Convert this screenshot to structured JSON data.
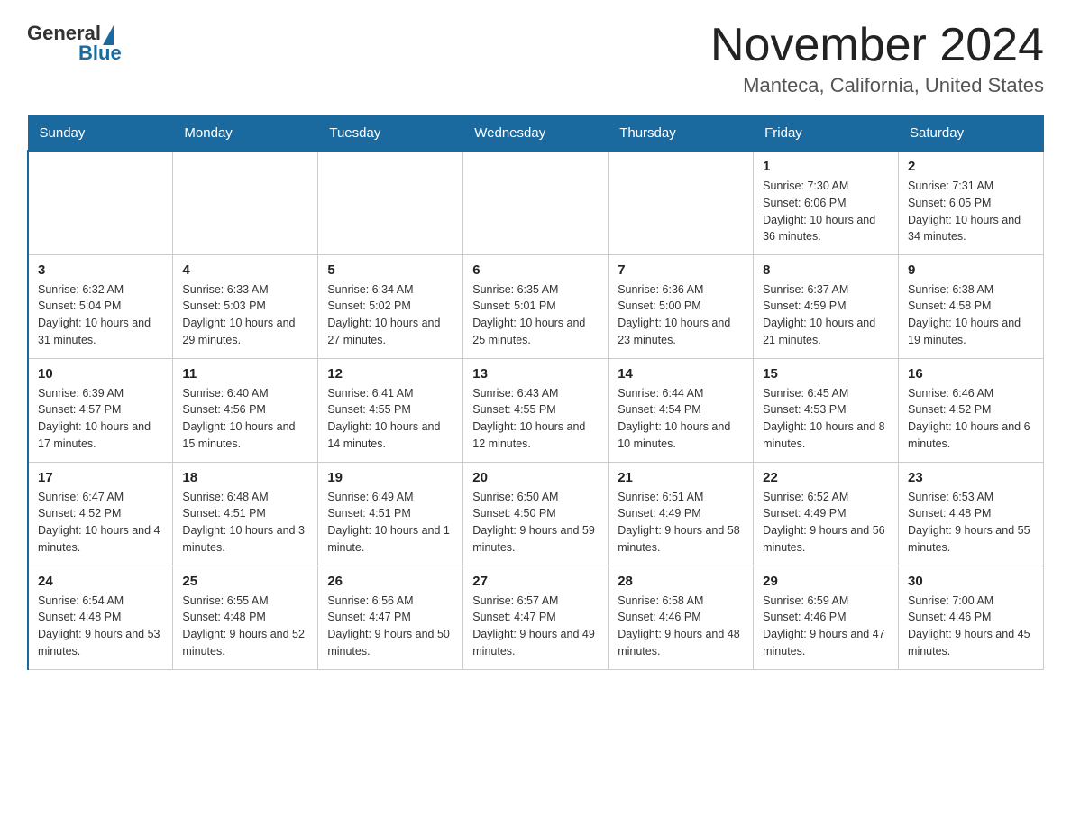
{
  "header": {
    "logo_general": "General",
    "logo_blue": "Blue",
    "month_title": "November 2024",
    "location": "Manteca, California, United States"
  },
  "days_of_week": [
    "Sunday",
    "Monday",
    "Tuesday",
    "Wednesday",
    "Thursday",
    "Friday",
    "Saturday"
  ],
  "weeks": [
    {
      "days": [
        {
          "number": "",
          "sunrise": "",
          "sunset": "",
          "daylight": "",
          "empty": true
        },
        {
          "number": "",
          "sunrise": "",
          "sunset": "",
          "daylight": "",
          "empty": true
        },
        {
          "number": "",
          "sunrise": "",
          "sunset": "",
          "daylight": "",
          "empty": true
        },
        {
          "number": "",
          "sunrise": "",
          "sunset": "",
          "daylight": "",
          "empty": true
        },
        {
          "number": "",
          "sunrise": "",
          "sunset": "",
          "daylight": "",
          "empty": true
        },
        {
          "number": "1",
          "sunrise": "Sunrise: 7:30 AM",
          "sunset": "Sunset: 6:06 PM",
          "daylight": "Daylight: 10 hours and 36 minutes.",
          "empty": false
        },
        {
          "number": "2",
          "sunrise": "Sunrise: 7:31 AM",
          "sunset": "Sunset: 6:05 PM",
          "daylight": "Daylight: 10 hours and 34 minutes.",
          "empty": false
        }
      ]
    },
    {
      "days": [
        {
          "number": "3",
          "sunrise": "Sunrise: 6:32 AM",
          "sunset": "Sunset: 5:04 PM",
          "daylight": "Daylight: 10 hours and 31 minutes.",
          "empty": false
        },
        {
          "number": "4",
          "sunrise": "Sunrise: 6:33 AM",
          "sunset": "Sunset: 5:03 PM",
          "daylight": "Daylight: 10 hours and 29 minutes.",
          "empty": false
        },
        {
          "number": "5",
          "sunrise": "Sunrise: 6:34 AM",
          "sunset": "Sunset: 5:02 PM",
          "daylight": "Daylight: 10 hours and 27 minutes.",
          "empty": false
        },
        {
          "number": "6",
          "sunrise": "Sunrise: 6:35 AM",
          "sunset": "Sunset: 5:01 PM",
          "daylight": "Daylight: 10 hours and 25 minutes.",
          "empty": false
        },
        {
          "number": "7",
          "sunrise": "Sunrise: 6:36 AM",
          "sunset": "Sunset: 5:00 PM",
          "daylight": "Daylight: 10 hours and 23 minutes.",
          "empty": false
        },
        {
          "number": "8",
          "sunrise": "Sunrise: 6:37 AM",
          "sunset": "Sunset: 4:59 PM",
          "daylight": "Daylight: 10 hours and 21 minutes.",
          "empty": false
        },
        {
          "number": "9",
          "sunrise": "Sunrise: 6:38 AM",
          "sunset": "Sunset: 4:58 PM",
          "daylight": "Daylight: 10 hours and 19 minutes.",
          "empty": false
        }
      ]
    },
    {
      "days": [
        {
          "number": "10",
          "sunrise": "Sunrise: 6:39 AM",
          "sunset": "Sunset: 4:57 PM",
          "daylight": "Daylight: 10 hours and 17 minutes.",
          "empty": false
        },
        {
          "number": "11",
          "sunrise": "Sunrise: 6:40 AM",
          "sunset": "Sunset: 4:56 PM",
          "daylight": "Daylight: 10 hours and 15 minutes.",
          "empty": false
        },
        {
          "number": "12",
          "sunrise": "Sunrise: 6:41 AM",
          "sunset": "Sunset: 4:55 PM",
          "daylight": "Daylight: 10 hours and 14 minutes.",
          "empty": false
        },
        {
          "number": "13",
          "sunrise": "Sunrise: 6:43 AM",
          "sunset": "Sunset: 4:55 PM",
          "daylight": "Daylight: 10 hours and 12 minutes.",
          "empty": false
        },
        {
          "number": "14",
          "sunrise": "Sunrise: 6:44 AM",
          "sunset": "Sunset: 4:54 PM",
          "daylight": "Daylight: 10 hours and 10 minutes.",
          "empty": false
        },
        {
          "number": "15",
          "sunrise": "Sunrise: 6:45 AM",
          "sunset": "Sunset: 4:53 PM",
          "daylight": "Daylight: 10 hours and 8 minutes.",
          "empty": false
        },
        {
          "number": "16",
          "sunrise": "Sunrise: 6:46 AM",
          "sunset": "Sunset: 4:52 PM",
          "daylight": "Daylight: 10 hours and 6 minutes.",
          "empty": false
        }
      ]
    },
    {
      "days": [
        {
          "number": "17",
          "sunrise": "Sunrise: 6:47 AM",
          "sunset": "Sunset: 4:52 PM",
          "daylight": "Daylight: 10 hours and 4 minutes.",
          "empty": false
        },
        {
          "number": "18",
          "sunrise": "Sunrise: 6:48 AM",
          "sunset": "Sunset: 4:51 PM",
          "daylight": "Daylight: 10 hours and 3 minutes.",
          "empty": false
        },
        {
          "number": "19",
          "sunrise": "Sunrise: 6:49 AM",
          "sunset": "Sunset: 4:51 PM",
          "daylight": "Daylight: 10 hours and 1 minute.",
          "empty": false
        },
        {
          "number": "20",
          "sunrise": "Sunrise: 6:50 AM",
          "sunset": "Sunset: 4:50 PM",
          "daylight": "Daylight: 9 hours and 59 minutes.",
          "empty": false
        },
        {
          "number": "21",
          "sunrise": "Sunrise: 6:51 AM",
          "sunset": "Sunset: 4:49 PM",
          "daylight": "Daylight: 9 hours and 58 minutes.",
          "empty": false
        },
        {
          "number": "22",
          "sunrise": "Sunrise: 6:52 AM",
          "sunset": "Sunset: 4:49 PM",
          "daylight": "Daylight: 9 hours and 56 minutes.",
          "empty": false
        },
        {
          "number": "23",
          "sunrise": "Sunrise: 6:53 AM",
          "sunset": "Sunset: 4:48 PM",
          "daylight": "Daylight: 9 hours and 55 minutes.",
          "empty": false
        }
      ]
    },
    {
      "days": [
        {
          "number": "24",
          "sunrise": "Sunrise: 6:54 AM",
          "sunset": "Sunset: 4:48 PM",
          "daylight": "Daylight: 9 hours and 53 minutes.",
          "empty": false
        },
        {
          "number": "25",
          "sunrise": "Sunrise: 6:55 AM",
          "sunset": "Sunset: 4:48 PM",
          "daylight": "Daylight: 9 hours and 52 minutes.",
          "empty": false
        },
        {
          "number": "26",
          "sunrise": "Sunrise: 6:56 AM",
          "sunset": "Sunset: 4:47 PM",
          "daylight": "Daylight: 9 hours and 50 minutes.",
          "empty": false
        },
        {
          "number": "27",
          "sunrise": "Sunrise: 6:57 AM",
          "sunset": "Sunset: 4:47 PM",
          "daylight": "Daylight: 9 hours and 49 minutes.",
          "empty": false
        },
        {
          "number": "28",
          "sunrise": "Sunrise: 6:58 AM",
          "sunset": "Sunset: 4:46 PM",
          "daylight": "Daylight: 9 hours and 48 minutes.",
          "empty": false
        },
        {
          "number": "29",
          "sunrise": "Sunrise: 6:59 AM",
          "sunset": "Sunset: 4:46 PM",
          "daylight": "Daylight: 9 hours and 47 minutes.",
          "empty": false
        },
        {
          "number": "30",
          "sunrise": "Sunrise: 7:00 AM",
          "sunset": "Sunset: 4:46 PM",
          "daylight": "Daylight: 9 hours and 45 minutes.",
          "empty": false
        }
      ]
    }
  ]
}
